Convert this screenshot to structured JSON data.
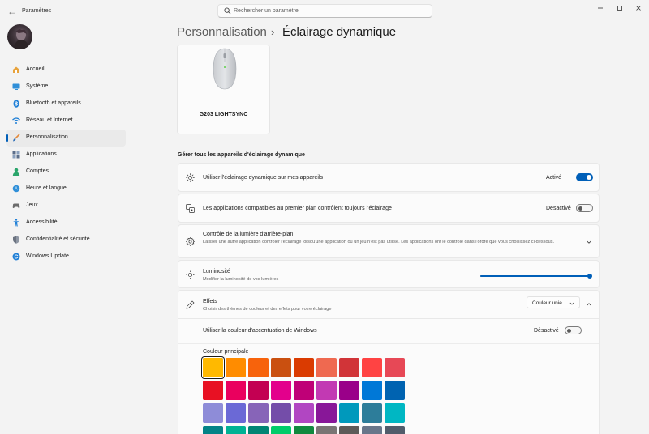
{
  "window": {
    "title": "Paramètres",
    "back_glyph": "←"
  },
  "search": {
    "placeholder": "Rechercher un paramètre",
    "icon": "search-icon"
  },
  "sidebar": {
    "items": [
      {
        "label": "Accueil",
        "icon": "home-icon",
        "color": "#e8a23a"
      },
      {
        "label": "Système",
        "icon": "system-icon",
        "color": "#2f8fd8"
      },
      {
        "label": "Bluetooth et appareils",
        "icon": "bluetooth-icon",
        "color": "#1f7fd6"
      },
      {
        "label": "Réseau et Internet",
        "icon": "wifi-icon",
        "color": "#1f7fd6"
      },
      {
        "label": "Personnalisation",
        "icon": "brush-icon",
        "color": "#e48a3b",
        "active": true
      },
      {
        "label": "Applications",
        "icon": "apps-icon",
        "color": "#5b6e8a"
      },
      {
        "label": "Comptes",
        "icon": "account-icon",
        "color": "#2aa56b"
      },
      {
        "label": "Heure et langue",
        "icon": "globe-clock-icon",
        "color": "#2f8fd8"
      },
      {
        "label": "Jeux",
        "icon": "gamepad-icon",
        "color": "#6b6b6b"
      },
      {
        "label": "Accessibilité",
        "icon": "accessibility-icon",
        "color": "#1f7fd6"
      },
      {
        "label": "Confidentialité et sécurité",
        "icon": "shield-icon",
        "color": "#6b7380"
      },
      {
        "label": "Windows Update",
        "icon": "update-icon",
        "color": "#1f7fd6"
      }
    ]
  },
  "breadcrumb": {
    "parent": "Personnalisation",
    "separator": "›",
    "current": "Éclairage dynamique"
  },
  "device": {
    "name": "G203 LIGHTSYNC"
  },
  "section": {
    "title": "Gérer tous les appareils d'éclairage dynamique"
  },
  "settings": {
    "use_dynamic_lighting": {
      "title": "Utiliser l'éclairage dynamique sur mes appareils",
      "state": "Activé",
      "on": true
    },
    "foreground_apps": {
      "title": "Les applications compatibles au premier plan contrôlent toujours l'éclairage",
      "state": "Désactivé",
      "on": false
    },
    "background_control": {
      "title": "Contrôle de la lumière d'arrière-plan",
      "description": "Laisser une autre application contrôler l'éclairage lorsqu'une application ou un jeu n'est pas utilisé. Les applications ont le contrôle dans l'ordre que vous choisissez ci-dessous."
    },
    "brightness": {
      "title": "Luminosité",
      "description": "Modifier la luminosité de vos lumières",
      "value_percent": 100
    },
    "effects": {
      "title": "Effets",
      "description": "Choisir des thèmes de couleur et des effets pour votre éclairage",
      "selected": "Couleur unie"
    },
    "accent_color": {
      "title": "Utiliser la couleur d'accentuation de Windows",
      "state": "Désactivé",
      "on": false
    }
  },
  "palette": {
    "title": "Couleur principale",
    "selected_index": 0,
    "rows": [
      [
        "#ffb900",
        "#ff8c00",
        "#f7630c",
        "#ca5010",
        "#da3b01",
        "#ef6950",
        "#d13438",
        "#ff4343",
        "#e74856"
      ],
      [
        "#e81123",
        "#ea005e",
        "#c30052",
        "#e3008c",
        "#bf0077",
        "#c239b3",
        "#9a0089",
        "#0078d7",
        "#0063b1"
      ],
      [
        "#8e8cd8",
        "#6b69d6",
        "#8764b8",
        "#744da9",
        "#b146c2",
        "#881798",
        "#0099bc",
        "#2d7d9a",
        "#00b7c3"
      ],
      [
        "#038387",
        "#00b294",
        "#018574",
        "#00cc6a",
        "#10893e",
        "#7a7574",
        "#5d5a58",
        "#68768a",
        "#515c6b"
      ]
    ]
  }
}
